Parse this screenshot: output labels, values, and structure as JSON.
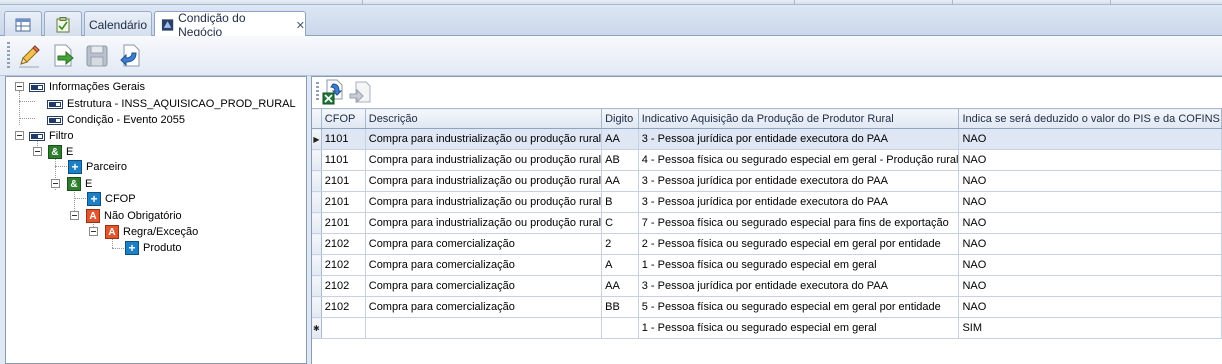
{
  "tabs": {
    "calendar_label": "Calendário",
    "active_label": "Condição do Negócio",
    "close_glyph": "✕"
  },
  "tree": {
    "info_root": "Informações Gerais",
    "estrutura": "Estrutura - INSS_AQUISICAO_PROD_RURAL",
    "condicao": "Condição - Evento 2055",
    "filtro": "Filtro",
    "and_1": "E",
    "parceiro": "Parceiro",
    "and_2": "E",
    "cfop": "CFOP",
    "nao_obrigatorio": "Não Obrigatório",
    "regra_excecao": "Regra/Exceção",
    "produto": "Produto",
    "and_glyph": "&",
    "plus_glyph": "+",
    "alert_glyph": "A"
  },
  "grid": {
    "columns": [
      "CFOP",
      "Descrição",
      "Digito",
      "Indicativo Aquisição da Produção de Produtor Rural",
      "Indica se será deduzido o valor do PIS e da COFINS"
    ],
    "current_row_glyph": "▶",
    "new_row_glyph": "✱",
    "rows": [
      {
        "cfop": "1101",
        "descricao": "Compra para industrialização ou produção rural",
        "digito": "AA",
        "indicativo": "3 - Pessoa jurídica por entidade executora do PAA",
        "deduz": "NAO"
      },
      {
        "cfop": "1101",
        "descricao": "Compra para industrialização ou produção rural",
        "digito": "AB",
        "indicativo": "4 - Pessoa física ou segurado especial em geral - Produção rural",
        "deduz": "NAO"
      },
      {
        "cfop": "2101",
        "descricao": "Compra para industrialização ou produção rural",
        "digito": "AA",
        "indicativo": "3 - Pessoa jurídica por entidade executora do PAA",
        "deduz": "NAO"
      },
      {
        "cfop": "2101",
        "descricao": "Compra para industrialização ou produção rural",
        "digito": "B",
        "indicativo": "3 - Pessoa jurídica por entidade executora do PAA",
        "deduz": "NAO"
      },
      {
        "cfop": "2101",
        "descricao": "Compra para industrialização ou produção rural",
        "digito": "C",
        "indicativo": "7 - Pessoa física ou segurado especial para fins de exportação",
        "deduz": "NAO"
      },
      {
        "cfop": "2102",
        "descricao": "Compra para comercialização",
        "digito": "2",
        "indicativo": "2 - Pessoa física ou segurado especial em geral por entidade",
        "deduz": "NAO"
      },
      {
        "cfop": "2102",
        "descricao": "Compra para comercialização",
        "digito": "A",
        "indicativo": "1 - Pessoa física ou segurado especial em geral",
        "deduz": "NAO"
      },
      {
        "cfop": "2102",
        "descricao": "Compra para comercialização",
        "digito": "AA",
        "indicativo": "3 - Pessoa jurídica por entidade executora do PAA",
        "deduz": "NAO"
      },
      {
        "cfop": "2102",
        "descricao": "Compra para comercialização",
        "digito": "BB",
        "indicativo": "5 - Pessoa física ou segurado especial em geral por entidade",
        "deduz": "NAO"
      },
      {
        "cfop": "",
        "descricao": "",
        "digito": "",
        "indicativo": "1 - Pessoa física ou segurado especial em geral",
        "deduz": "SIM"
      }
    ]
  },
  "colors": {
    "accent": "#3b6fb6",
    "selected_row": "#dfe7f4"
  }
}
